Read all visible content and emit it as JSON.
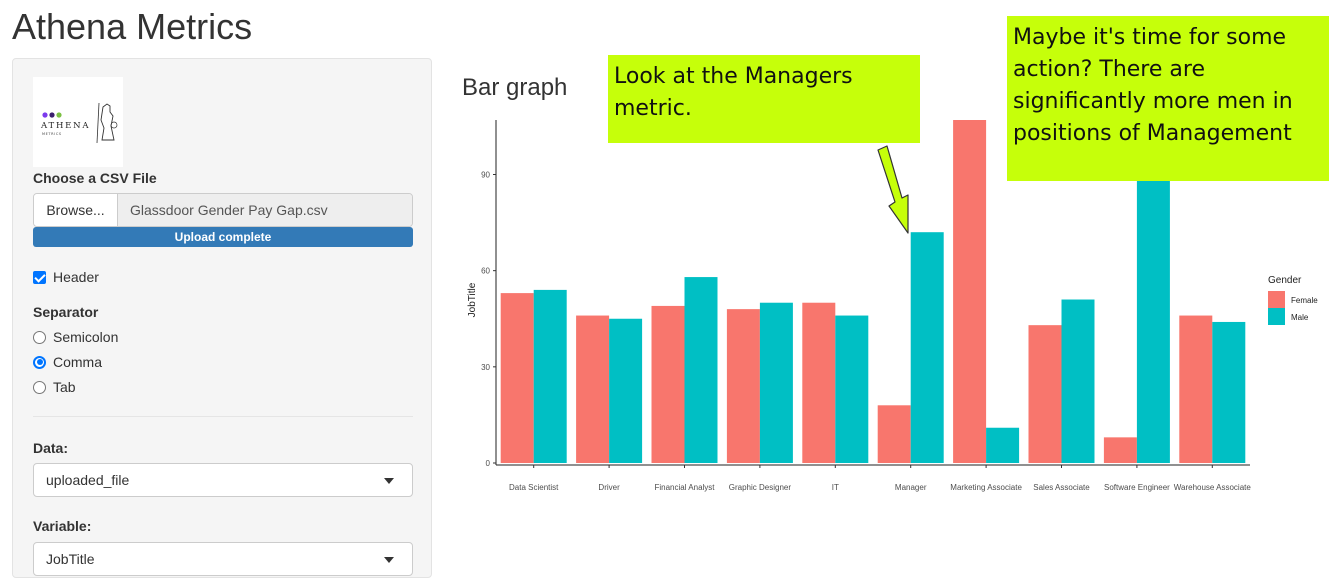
{
  "app": {
    "title": "Athena Metrics"
  },
  "sidebar": {
    "logo": {
      "brand": "ATHENA",
      "sub": "METRICS"
    },
    "file_input": {
      "label": "Choose a CSV File",
      "browse_label": "Browse...",
      "filename": "Glassdoor Gender Pay Gap.csv",
      "progress_text": "Upload complete",
      "progress": 1.0
    },
    "header_checkbox": {
      "label": "Header",
      "checked": true
    },
    "separator": {
      "label": "Separator",
      "options": [
        "Semicolon",
        "Comma",
        "Tab"
      ],
      "selected": "Comma"
    },
    "data_select": {
      "label": "Data:",
      "value": "uploaded_file"
    },
    "variable_select": {
      "label": "Variable:",
      "value": "JobTitle"
    }
  },
  "main": {
    "plot_title": "Bar graph"
  },
  "callouts": {
    "managers": "Look at the Managers metric.",
    "action": "Maybe it's time for some action? There are significantly more men in positions of Management"
  },
  "colors": {
    "female": "#f8766d",
    "male": "#00bfc4",
    "callout": "#c6ff0a",
    "progress": "#337ab7"
  },
  "chart_data": {
    "type": "bar",
    "ylabel": "JobTitle",
    "xlabel": "",
    "ylim": [
      0,
      107
    ],
    "yticks": [
      0,
      30,
      60,
      90
    ],
    "legend_title": "Gender",
    "legend_position": "right",
    "grid": false,
    "categories": [
      "Data Scientist",
      "Driver",
      "Financial Analyst",
      "Graphic Designer",
      "IT",
      "Manager",
      "Marketing Associate",
      "Sales Associate",
      "Software Engineer",
      "Warehouse Associate"
    ],
    "series": [
      {
        "name": "Female",
        "values": [
          53,
          46,
          49,
          48,
          50,
          18,
          107,
          43,
          8,
          46
        ]
      },
      {
        "name": "Male",
        "values": [
          54,
          45,
          58,
          50,
          46,
          72,
          11,
          51,
          109,
          44
        ]
      }
    ]
  }
}
